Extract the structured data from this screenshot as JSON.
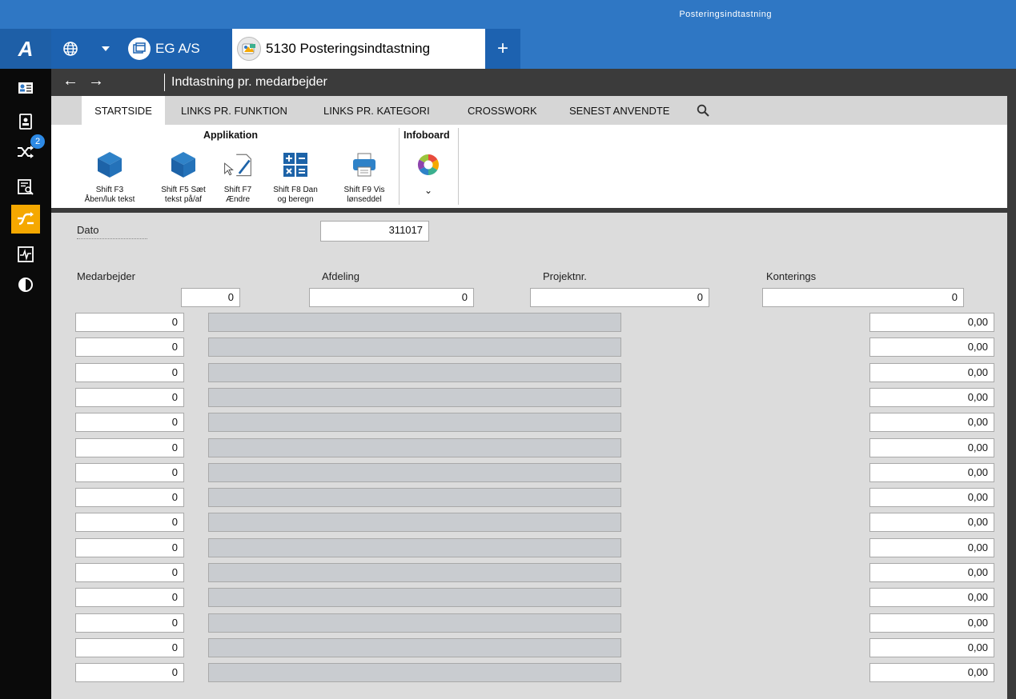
{
  "window": {
    "title": "Posteringsindtastning"
  },
  "app": {
    "logo_letter": "A"
  },
  "tabs": [
    {
      "label": "EG A/S",
      "icon": "window-icon"
    },
    {
      "label": "5130 Posteringsindtastning",
      "icon": "app-icon"
    }
  ],
  "add_tab_label": "+",
  "breadcrumb": "Indtastning pr. medarbejder",
  "nav": {
    "back": "←",
    "forward": "→"
  },
  "ribbon_tabs": [
    "STARTSIDE",
    "LINKS PR. FUNKTION",
    "LINKS PR. KATEGORI",
    "CROSSWORK",
    "SENEST ANVENDTE"
  ],
  "ribbon": {
    "group_application": "Applikation",
    "group_infoboard": "Infoboard",
    "buttons": [
      {
        "line1": "Shift F3",
        "line2": "Åben/luk tekst",
        "icon": "cube-icon"
      },
      {
        "line1": "Shift F5 Sæt",
        "line2": "tekst på/af",
        "icon": "cube-icon"
      },
      {
        "line1": "Shift F7",
        "line2": "Ændre",
        "icon": "edit-document-icon"
      },
      {
        "line1": "Shift F8 Dan",
        "line2": "og beregn",
        "icon": "calculator-icon"
      },
      {
        "line1": "Shift F9 Vis",
        "line2": "lønseddel",
        "icon": "printer-icon"
      }
    ],
    "infoboard_icon": "color-wheel-icon",
    "infoboard_chevron": "⌄"
  },
  "sidebar": {
    "badge_count": "2",
    "active_index": 4
  },
  "form": {
    "dato_label": "Dato",
    "dato_value": "311017",
    "columns": {
      "medarbejder": "Medarbejder",
      "afdeling": "Afdeling",
      "projekt": "Projektnr.",
      "konterings": "Konterings"
    },
    "header_values": {
      "medarbejder": "0",
      "afdeling": "0",
      "projekt": "0",
      "konterings": "0"
    },
    "rows": [
      {
        "num": "0",
        "amount": "0,00"
      },
      {
        "num": "0",
        "amount": "0,00"
      },
      {
        "num": "0",
        "amount": "0,00"
      },
      {
        "num": "0",
        "amount": "0,00"
      },
      {
        "num": "0",
        "amount": "0,00"
      },
      {
        "num": "0",
        "amount": "0,00"
      },
      {
        "num": "0",
        "amount": "0,00"
      },
      {
        "num": "0",
        "amount": "0,00"
      },
      {
        "num": "0",
        "amount": "0,00"
      },
      {
        "num": "0",
        "amount": "0,00"
      },
      {
        "num": "0",
        "amount": "0,00"
      },
      {
        "num": "0",
        "amount": "0,00"
      },
      {
        "num": "0",
        "amount": "0,00"
      },
      {
        "num": "0",
        "amount": "0,00"
      },
      {
        "num": "0",
        "amount": "0,00"
      }
    ]
  },
  "colors": {
    "titlebar": "#2f77c4",
    "accent": "#f5a800",
    "dark": "#3b3b3b",
    "form_bg": "#dcdcdc"
  }
}
